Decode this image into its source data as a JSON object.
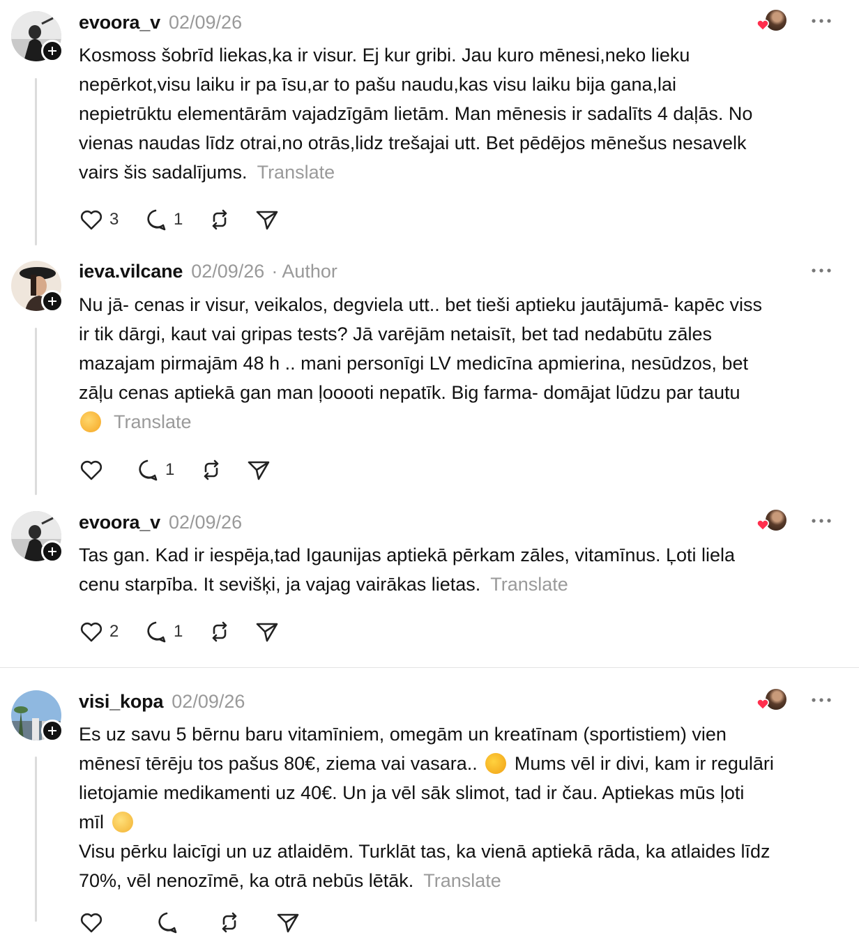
{
  "posts": [
    {
      "username": "evoora_v",
      "date": "02/09/26",
      "author_tag": "",
      "lines": [
        "Kosmoss šobrīd liekas,ka ir visur. Ej kur gribi. Jau kuro mēnesi,neko lieku",
        "nepērkot,visu laiku ir pa īsu,ar to pašu naudu,kas visu laiku bija gana,lai",
        "nepietrūktu elementārām vajadzīgām lietām. Man mēnesis ir sadalīts 4 daļās. No",
        "vienas naudas līdz otrai,no otrās,lidz trešajai utt. Bet pēdējos mēnešus nesavelk",
        "vairs šis sadalījums."
      ],
      "translate": "Translate",
      "likes": "3",
      "replies": "1",
      "author_liked": true
    },
    {
      "username": "ieva.vilcane",
      "date": "02/09/26",
      "author_tag": "· Author",
      "lines": [
        "Nu jā- cenas ir visur, veikalos, degviela utt.. bet tieši aptieku jautājumā- kapēc viss",
        "ir tik dārgi, kaut vai gripas tests? Jā varējām netaisīt, bet tad nedabūtu zāles",
        "mazajam pirmajām 48 h .. mani personīgi LV medicīna apmierina, nesūdzos, bet",
        "zāļu cenas aptiekā gan man ļooooti nepatīk. Big farma- domājat lūdzu par tautu",
        ""
      ],
      "translate": "Translate",
      "likes": "",
      "replies": "1",
      "author_liked": false
    },
    {
      "username": "evoora_v",
      "date": "02/09/26",
      "author_tag": "",
      "lines": [
        "Tas gan. Kad ir iespēja,tad Igaunijas aptiekā pērkam zāles, vitamīnus. Ļoti liela",
        "cenu starpība. It sevišķi, ja vajag vairākas lietas."
      ],
      "translate": "Translate",
      "likes": "2",
      "replies": "1",
      "author_liked": true
    },
    {
      "username": "visi_kopa",
      "date": "02/09/26",
      "author_tag": "",
      "lines": [
        "Es uz savu 5 bērnu baru vitamīniem, omegām un kreatīnam (sportistiem) vien",
        "mēnesī tērēju tos pašus 80€, ziema vai vasara..",
        "Mums vēl ir divi, kam ir regulāri",
        "lietojamie medikamenti uz 40€. Un ja vēl sāk slimot, tad ir čau. Aptiekas mūs ļoti",
        "mīl",
        "Visu pērku laicīgi un uz atlaidēm. Turklāt tas, ka vienā aptiekā rāda, ka atlaides līdz",
        "70%, vēl nenozīmē, ka otrā nebūs lētāk."
      ],
      "translate": "Translate",
      "likes": "",
      "replies": "",
      "author_liked": true
    }
  ],
  "icons": {
    "like": "heart-outline-icon",
    "reply": "speech-bubble-icon",
    "repost": "repost-arrows-icon",
    "share": "paper-plane-icon",
    "more": "more-dots-icon",
    "author_like": "liked-by-author-icon"
  },
  "colors": {
    "text": "#111111",
    "muted": "#999999",
    "heart": "#ff2e4d",
    "thread": "#dcdcdc"
  }
}
